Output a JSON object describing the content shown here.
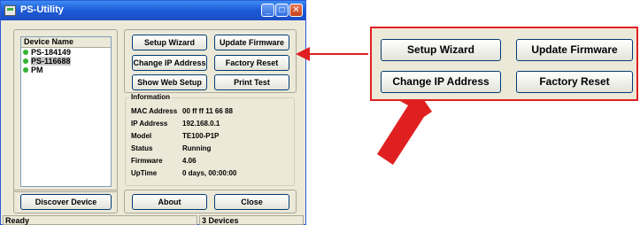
{
  "window": {
    "title": "PS-Utility",
    "minimize": "_",
    "maximize": "□",
    "close": "✕"
  },
  "device_list": {
    "header": "Device Name",
    "items": [
      {
        "name": "PS-184149",
        "selected": false
      },
      {
        "name": "PS-116688",
        "selected": true
      },
      {
        "name": "PM",
        "selected": false
      }
    ]
  },
  "buttons": {
    "setup_wizard": "Setup Wizard",
    "update_firmware": "Update Firmware",
    "change_ip": "Change IP Address",
    "factory_reset": "Factory Reset",
    "show_web_setup": "Show Web Setup",
    "print_test": "Print Test",
    "discover_device": "Discover Device",
    "about": "About",
    "close": "Close"
  },
  "information": {
    "label": "Information",
    "rows": [
      {
        "key": "MAC Address",
        "value": "00 ff ff 11 66 88"
      },
      {
        "key": "IP Address",
        "value": "192.168.0.1"
      },
      {
        "key": "Model",
        "value": "TE100-P1P"
      },
      {
        "key": "Status",
        "value": "Running"
      },
      {
        "key": "Firmware",
        "value": "4.06"
      },
      {
        "key": "UpTime",
        "value": "0 days, 00:00:00"
      }
    ]
  },
  "statusbar": {
    "left": "Ready",
    "right": "3 Devices"
  },
  "callout": {
    "setup_wizard": "Setup Wizard",
    "update_firmware": "Update Firmware",
    "change_ip": "Change IP Address",
    "factory_reset": "Factory Reset"
  },
  "colors": {
    "accent_red": "#e02020",
    "device_dot": "#33b233",
    "titlebar": "#1c5ad6"
  }
}
